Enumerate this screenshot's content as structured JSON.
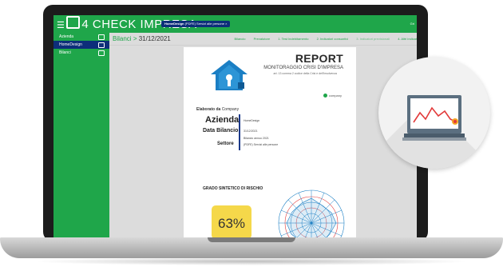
{
  "app": {
    "brand": "4 CHECK IMPRESA",
    "chip_company": "HomeDesign",
    "chip_detail": "(PDFE) Servizi alle persone",
    "top_right": "Gri"
  },
  "sidebar": {
    "items": [
      {
        "label": "Azienda"
      },
      {
        "label": "HomeDesign"
      },
      {
        "label": "Bilanci"
      }
    ]
  },
  "header": {
    "breadcrumb_root": "Bilanci",
    "breadcrumb_sep": ">",
    "breadcrumb_date": "31/12/2021",
    "tabs": [
      {
        "label": "Bilancio"
      },
      {
        "label": "Prevalutore"
      },
      {
        "label": "1. Test Indebitamento"
      },
      {
        "label": "2. Indicatori consuntivi"
      },
      {
        "label": "3. Indicatori previsionali"
      },
      {
        "label": "4. Altri indicat"
      }
    ]
  },
  "report": {
    "title": "REPORT",
    "subtitle": "MONITORAGGIO CRISI D'IMPRESA",
    "note": "art. 13 comma 2 codice della Crisi e dell'Insolvenza",
    "company_brand": "company",
    "elaborato_label": "Elaborato da",
    "elaborato_value": "Company",
    "azienda_label": "Azienda",
    "azienda_value": "HomeDesign",
    "data_bilancio_label": "Data Bilancio",
    "data_bilancio_value": "31/12/2021",
    "extra_value": "Bilancio annuo 2021",
    "settore_label": "Settore",
    "settore_value": "(PDFE) Servizi alle persone",
    "grado_label": "GRADO SINTETICO DI RISCHIO",
    "grado_value": "63%",
    "grado_fill": 0.63
  },
  "colors": {
    "brand_green": "#1fa64a",
    "nav_blue": "#0d2e7a",
    "house_blue": "#1b7fc4",
    "score_yellow": "#f5d84a",
    "chart_red": "#e23a3a"
  },
  "icons": [
    "menu-icon",
    "app-logo-icon",
    "folder-icon",
    "list-icon",
    "house-logo-icon",
    "line-chart-icon"
  ]
}
